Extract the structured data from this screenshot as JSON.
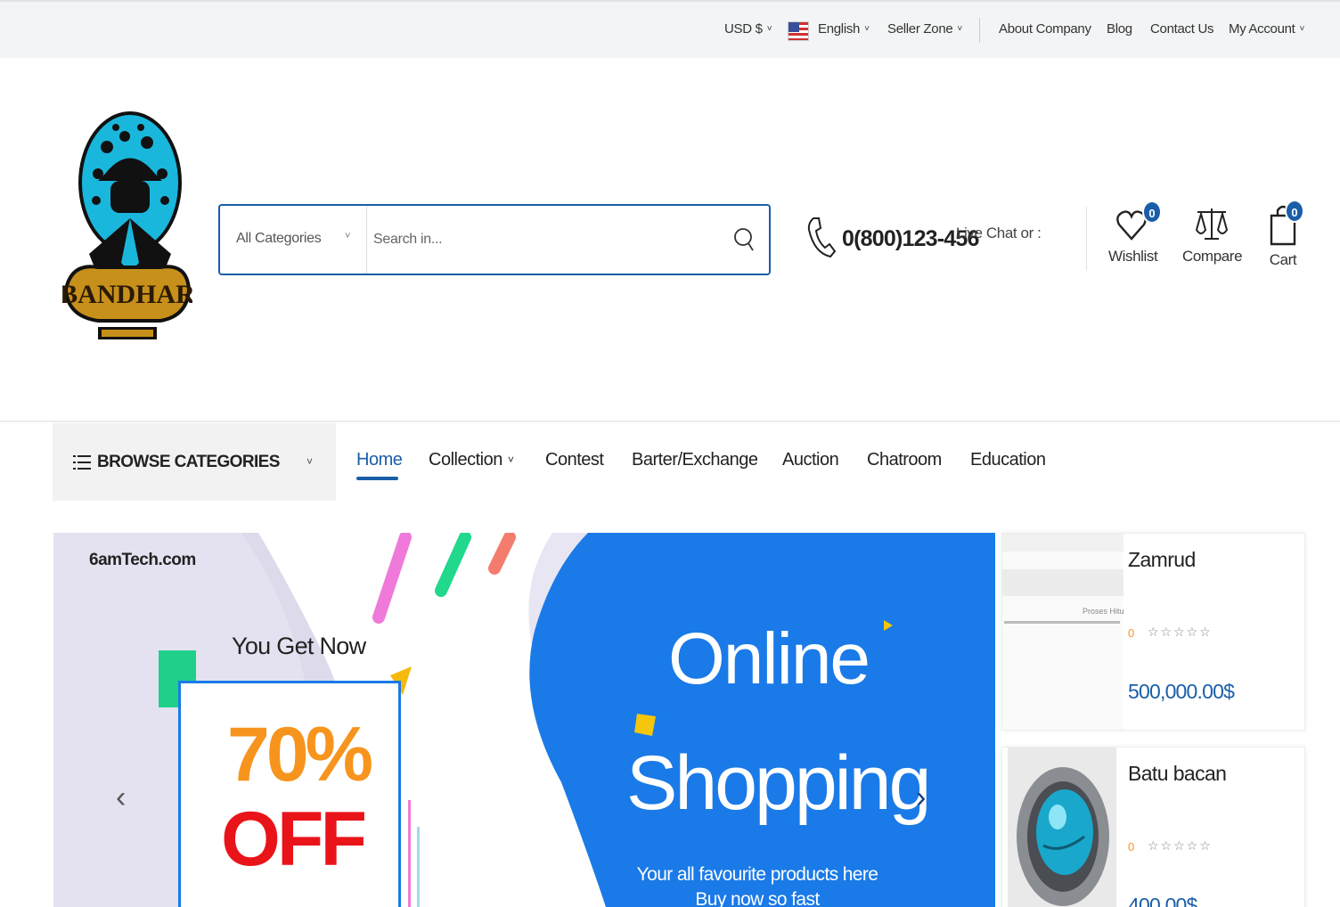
{
  "topbar": {
    "currency": "USD $",
    "language": "English",
    "seller_zone": "Seller Zone",
    "about": "About Company",
    "blog": "Blog",
    "contact": "Contact Us",
    "account": "My Account"
  },
  "header": {
    "logo_text": "BANDHAR",
    "search_category": "All Categories",
    "search_placeholder": "Search in...",
    "phone": "0(800)123-456",
    "live_chat": "Live Chat or :",
    "wishlist_label": "Wishlist",
    "wishlist_count": "0",
    "compare_label": "Compare",
    "cart_label": "Cart",
    "cart_count": "0"
  },
  "nav": {
    "browse_label": "BROWSE CATEGORIES",
    "links": [
      "Home",
      "Collection",
      "Contest",
      "Barter/Exchange",
      "Auction",
      "Chatroom",
      "Education"
    ],
    "active_index": 0
  },
  "banner": {
    "brand": "6amTech.com",
    "you_get": "You Get Now",
    "percent": "70%",
    "off": "OFF",
    "headline_1": "Online",
    "headline_2": "Shopping",
    "subline": "Your all favourite products here Buy now so fast"
  },
  "side_products": [
    {
      "name": "Zamrud",
      "rating_count": "0",
      "stars": "☆☆☆☆☆",
      "price": "500,000.00$",
      "thumb_text": "Proses Hitu"
    },
    {
      "name": "Batu bacan",
      "rating_count": "0",
      "stars": "☆☆☆☆☆",
      "price": "400.00$"
    }
  ],
  "colors": {
    "primary": "#1a5ea8",
    "banner_blue": "#1a7ae8",
    "orange": "#f7941d",
    "red": "#e9141a"
  }
}
